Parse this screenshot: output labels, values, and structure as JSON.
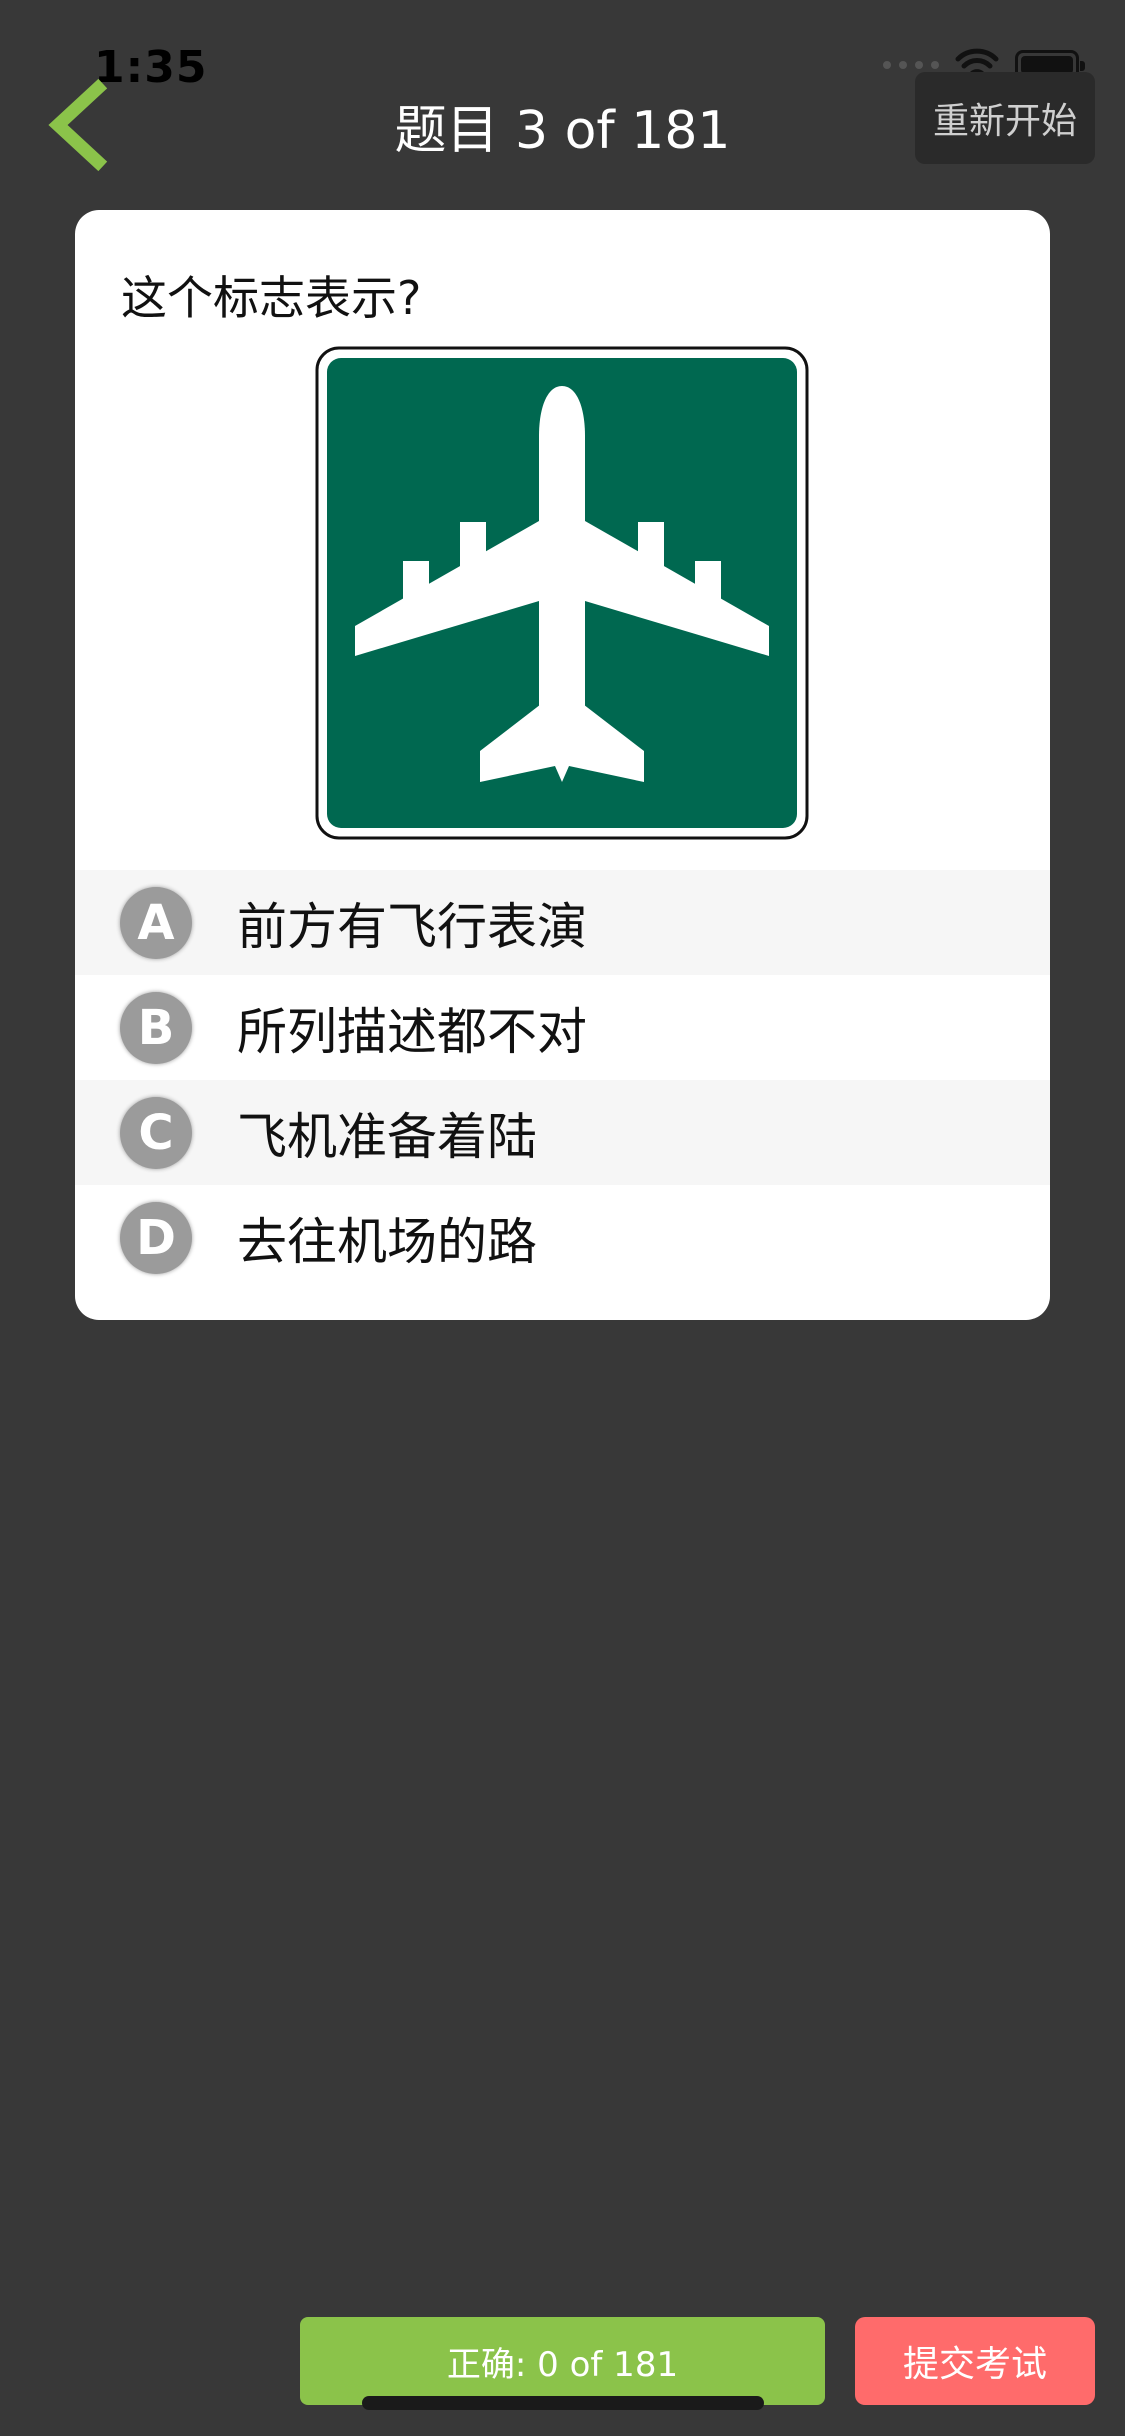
{
  "status_bar": {
    "time": "1:35"
  },
  "nav": {
    "title": "题目 3 of 181",
    "restart_label": "重新开始"
  },
  "question": {
    "text": "这个标志表示?",
    "sign_icon": "airport-sign-icon",
    "sign_color": "#006850",
    "options": [
      {
        "letter": "A",
        "text": "前方有飞行表演"
      },
      {
        "letter": "B",
        "text": "所列描述都不对"
      },
      {
        "letter": "C",
        "text": "飞机准备着陆"
      },
      {
        "letter": "D",
        "text": "去往机场的路"
      }
    ]
  },
  "footer": {
    "score_label": "正确: 0 of 181",
    "submit_label": "提交考试"
  },
  "colors": {
    "background": "#383838",
    "accent_green": "#8bc34a",
    "submit_red": "#ff6b6b",
    "badge_gray": "#9b9b9b"
  }
}
